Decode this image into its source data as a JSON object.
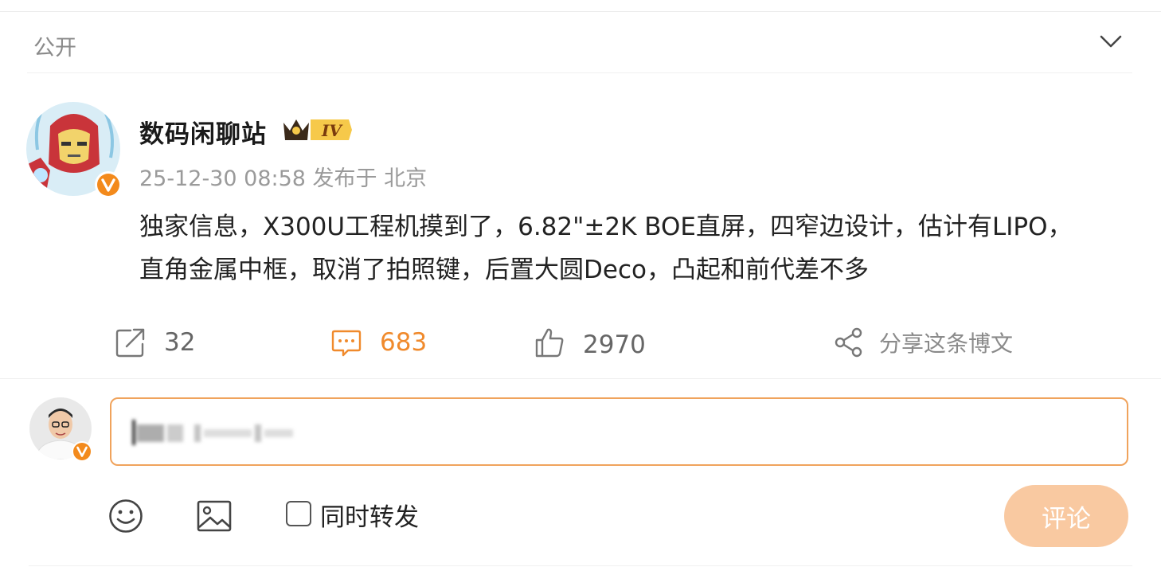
{
  "visibility": {
    "label": "公开"
  },
  "post": {
    "author": "数码闲聊站",
    "timestamp": "25-12-30 08:58",
    "location_prefix": "发布于",
    "location": "北京",
    "text": "独家信息，X300U工程机摸到了，6.82\"±2K BOE直屏，四窄边设计，估计有LIPO，直角金属中框，取消了拍照键，后置大圆Deco，凸起和前代差不多"
  },
  "actions": {
    "repost_count": "32",
    "comment_count": "683",
    "like_count": "2970",
    "share_label": "分享这条博文"
  },
  "comment_form": {
    "sync_label": "同时转发",
    "submit_label": "评论"
  },
  "colors": {
    "accent": "#f08a2c",
    "submit_disabled": "#f9c9a1",
    "input_border": "#f0a35c"
  },
  "icons": [
    "chevron-down-icon",
    "repost-icon",
    "comment-icon",
    "like-icon",
    "share-icon",
    "emoji-icon",
    "image-icon",
    "verified-badge-icon",
    "vip-crown-icon"
  ]
}
